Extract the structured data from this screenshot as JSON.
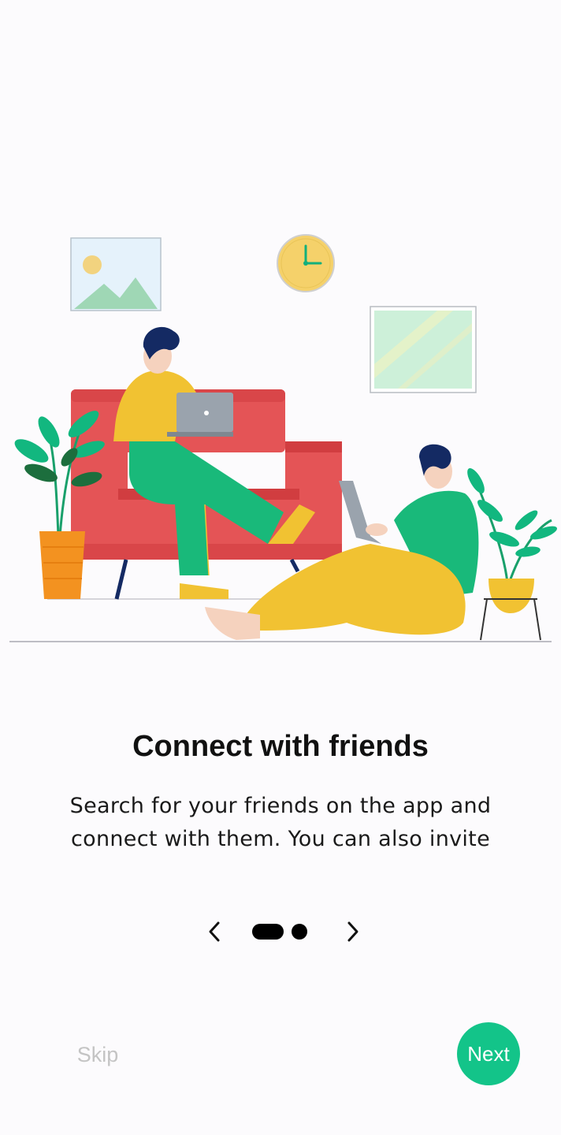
{
  "onboarding": {
    "title": "Connect with friends",
    "description": "Search for your friends on the app and connect with them. You can also invite",
    "pager": {
      "page_count": 2,
      "current_page": 1
    },
    "skip_label": "Skip",
    "next_label": "Next"
  },
  "icons": {
    "prev": "chevron-left-icon",
    "next": "chevron-right-icon",
    "illustration": "friends-on-sofa-illustration"
  },
  "colors": {
    "accent": "#13c489",
    "sofa": "#e45456",
    "shirt_yellow": "#f1c232",
    "pants_green": "#19b97a",
    "hair": "#142a63",
    "skin": "#f5d2be",
    "laptop": "#9aa3ad",
    "clock": "#f5d16a",
    "pot_orange": "#f39220"
  }
}
